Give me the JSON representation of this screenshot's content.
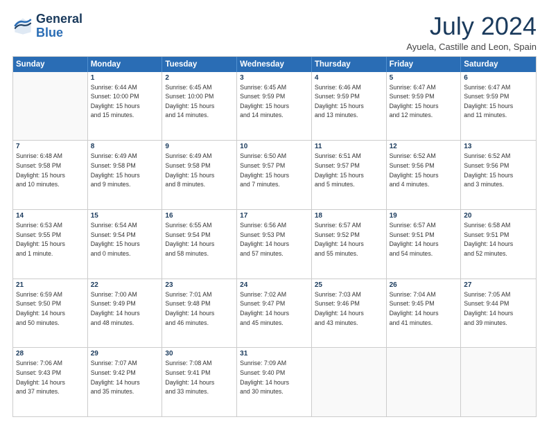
{
  "header": {
    "logo_line1": "General",
    "logo_line2": "Blue",
    "month_title": "July 2024",
    "location": "Ayuela, Castille and Leon, Spain"
  },
  "weekdays": [
    "Sunday",
    "Monday",
    "Tuesday",
    "Wednesday",
    "Thursday",
    "Friday",
    "Saturday"
  ],
  "rows": [
    [
      {
        "day": "",
        "lines": []
      },
      {
        "day": "1",
        "lines": [
          "Sunrise: 6:44 AM",
          "Sunset: 10:00 PM",
          "Daylight: 15 hours",
          "and 15 minutes."
        ]
      },
      {
        "day": "2",
        "lines": [
          "Sunrise: 6:45 AM",
          "Sunset: 10:00 PM",
          "Daylight: 15 hours",
          "and 14 minutes."
        ]
      },
      {
        "day": "3",
        "lines": [
          "Sunrise: 6:45 AM",
          "Sunset: 9:59 PM",
          "Daylight: 15 hours",
          "and 14 minutes."
        ]
      },
      {
        "day": "4",
        "lines": [
          "Sunrise: 6:46 AM",
          "Sunset: 9:59 PM",
          "Daylight: 15 hours",
          "and 13 minutes."
        ]
      },
      {
        "day": "5",
        "lines": [
          "Sunrise: 6:47 AM",
          "Sunset: 9:59 PM",
          "Daylight: 15 hours",
          "and 12 minutes."
        ]
      },
      {
        "day": "6",
        "lines": [
          "Sunrise: 6:47 AM",
          "Sunset: 9:59 PM",
          "Daylight: 15 hours",
          "and 11 minutes."
        ]
      }
    ],
    [
      {
        "day": "7",
        "lines": [
          "Sunrise: 6:48 AM",
          "Sunset: 9:58 PM",
          "Daylight: 15 hours",
          "and 10 minutes."
        ]
      },
      {
        "day": "8",
        "lines": [
          "Sunrise: 6:49 AM",
          "Sunset: 9:58 PM",
          "Daylight: 15 hours",
          "and 9 minutes."
        ]
      },
      {
        "day": "9",
        "lines": [
          "Sunrise: 6:49 AM",
          "Sunset: 9:58 PM",
          "Daylight: 15 hours",
          "and 8 minutes."
        ]
      },
      {
        "day": "10",
        "lines": [
          "Sunrise: 6:50 AM",
          "Sunset: 9:57 PM",
          "Daylight: 15 hours",
          "and 7 minutes."
        ]
      },
      {
        "day": "11",
        "lines": [
          "Sunrise: 6:51 AM",
          "Sunset: 9:57 PM",
          "Daylight: 15 hours",
          "and 5 minutes."
        ]
      },
      {
        "day": "12",
        "lines": [
          "Sunrise: 6:52 AM",
          "Sunset: 9:56 PM",
          "Daylight: 15 hours",
          "and 4 minutes."
        ]
      },
      {
        "day": "13",
        "lines": [
          "Sunrise: 6:52 AM",
          "Sunset: 9:56 PM",
          "Daylight: 15 hours",
          "and 3 minutes."
        ]
      }
    ],
    [
      {
        "day": "14",
        "lines": [
          "Sunrise: 6:53 AM",
          "Sunset: 9:55 PM",
          "Daylight: 15 hours",
          "and 1 minute."
        ]
      },
      {
        "day": "15",
        "lines": [
          "Sunrise: 6:54 AM",
          "Sunset: 9:54 PM",
          "Daylight: 15 hours",
          "and 0 minutes."
        ]
      },
      {
        "day": "16",
        "lines": [
          "Sunrise: 6:55 AM",
          "Sunset: 9:54 PM",
          "Daylight: 14 hours",
          "and 58 minutes."
        ]
      },
      {
        "day": "17",
        "lines": [
          "Sunrise: 6:56 AM",
          "Sunset: 9:53 PM",
          "Daylight: 14 hours",
          "and 57 minutes."
        ]
      },
      {
        "day": "18",
        "lines": [
          "Sunrise: 6:57 AM",
          "Sunset: 9:52 PM",
          "Daylight: 14 hours",
          "and 55 minutes."
        ]
      },
      {
        "day": "19",
        "lines": [
          "Sunrise: 6:57 AM",
          "Sunset: 9:51 PM",
          "Daylight: 14 hours",
          "and 54 minutes."
        ]
      },
      {
        "day": "20",
        "lines": [
          "Sunrise: 6:58 AM",
          "Sunset: 9:51 PM",
          "Daylight: 14 hours",
          "and 52 minutes."
        ]
      }
    ],
    [
      {
        "day": "21",
        "lines": [
          "Sunrise: 6:59 AM",
          "Sunset: 9:50 PM",
          "Daylight: 14 hours",
          "and 50 minutes."
        ]
      },
      {
        "day": "22",
        "lines": [
          "Sunrise: 7:00 AM",
          "Sunset: 9:49 PM",
          "Daylight: 14 hours",
          "and 48 minutes."
        ]
      },
      {
        "day": "23",
        "lines": [
          "Sunrise: 7:01 AM",
          "Sunset: 9:48 PM",
          "Daylight: 14 hours",
          "and 46 minutes."
        ]
      },
      {
        "day": "24",
        "lines": [
          "Sunrise: 7:02 AM",
          "Sunset: 9:47 PM",
          "Daylight: 14 hours",
          "and 45 minutes."
        ]
      },
      {
        "day": "25",
        "lines": [
          "Sunrise: 7:03 AM",
          "Sunset: 9:46 PM",
          "Daylight: 14 hours",
          "and 43 minutes."
        ]
      },
      {
        "day": "26",
        "lines": [
          "Sunrise: 7:04 AM",
          "Sunset: 9:45 PM",
          "Daylight: 14 hours",
          "and 41 minutes."
        ]
      },
      {
        "day": "27",
        "lines": [
          "Sunrise: 7:05 AM",
          "Sunset: 9:44 PM",
          "Daylight: 14 hours",
          "and 39 minutes."
        ]
      }
    ],
    [
      {
        "day": "28",
        "lines": [
          "Sunrise: 7:06 AM",
          "Sunset: 9:43 PM",
          "Daylight: 14 hours",
          "and 37 minutes."
        ]
      },
      {
        "day": "29",
        "lines": [
          "Sunrise: 7:07 AM",
          "Sunset: 9:42 PM",
          "Daylight: 14 hours",
          "and 35 minutes."
        ]
      },
      {
        "day": "30",
        "lines": [
          "Sunrise: 7:08 AM",
          "Sunset: 9:41 PM",
          "Daylight: 14 hours",
          "and 33 minutes."
        ]
      },
      {
        "day": "31",
        "lines": [
          "Sunrise: 7:09 AM",
          "Sunset: 9:40 PM",
          "Daylight: 14 hours",
          "and 30 minutes."
        ]
      },
      {
        "day": "",
        "lines": []
      },
      {
        "day": "",
        "lines": []
      },
      {
        "day": "",
        "lines": []
      }
    ]
  ]
}
